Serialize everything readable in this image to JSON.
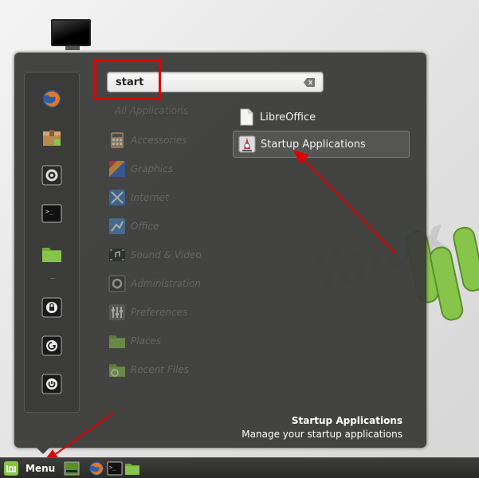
{
  "search": {
    "value": "start"
  },
  "categories": [
    {
      "label": "All Applications",
      "icon": "all-apps-icon"
    },
    {
      "label": "Accessories",
      "icon": "accessories-icon"
    },
    {
      "label": "Graphics",
      "icon": "graphics-icon"
    },
    {
      "label": "Internet",
      "icon": "internet-icon"
    },
    {
      "label": "Office",
      "icon": "office-icon"
    },
    {
      "label": "Sound & Video",
      "icon": "sound-video-icon"
    },
    {
      "label": "Administration",
      "icon": "administration-icon"
    },
    {
      "label": "Preferences",
      "icon": "preferences-icon"
    },
    {
      "label": "Places",
      "icon": "places-icon"
    },
    {
      "label": "Recent Files",
      "icon": "recent-files-icon"
    }
  ],
  "results": [
    {
      "label": "LibreOffice",
      "icon": "document-icon",
      "selected": false
    },
    {
      "label": "Startup Applications",
      "icon": "startup-applications-icon",
      "selected": true
    }
  ],
  "description": {
    "title": "Startup Applications",
    "text": "Manage your startup applications"
  },
  "favorites": [
    {
      "icon": "firefox-icon"
    },
    {
      "icon": "package-manager-icon"
    },
    {
      "icon": "system-settings-icon"
    },
    {
      "icon": "terminal-icon"
    },
    {
      "icon": "folder-icon"
    },
    {
      "icon": "lock-screen-icon"
    },
    {
      "icon": "logout-icon"
    },
    {
      "icon": "shutdown-icon"
    }
  ],
  "taskbar": {
    "menu_label": "Menu",
    "items": [
      {
        "icon": "show-desktop-icon"
      },
      {
        "icon": "firefox-icon"
      },
      {
        "icon": "terminal-icon"
      },
      {
        "icon": "folder-icon"
      }
    ]
  },
  "colors": {
    "panel_bg": "#3c3c3a",
    "accent_green": "#87c44b",
    "annotation_red": "#e00000"
  }
}
